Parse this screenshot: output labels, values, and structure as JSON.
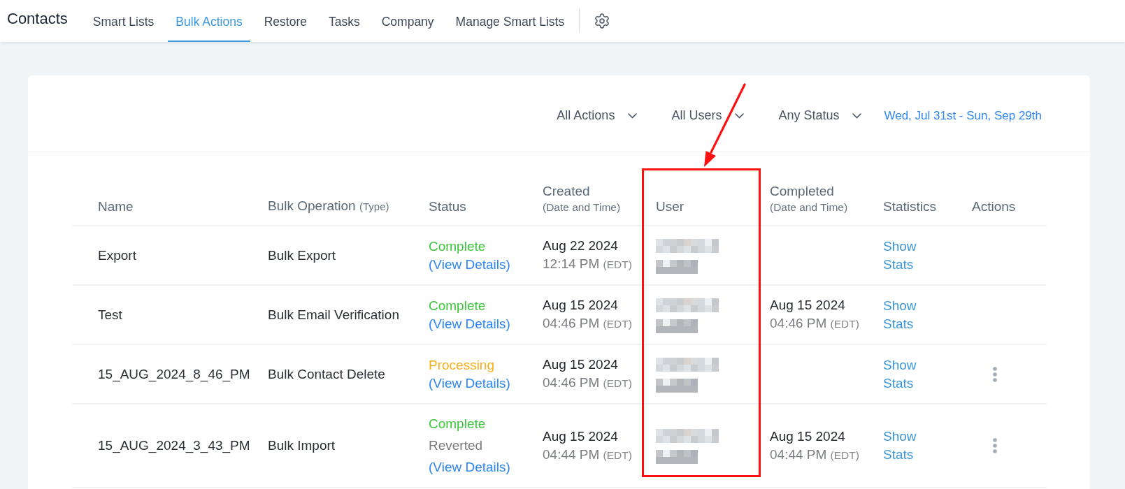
{
  "top_bar": {
    "title": "Contacts",
    "tabs": [
      {
        "label": "Smart Lists",
        "selected": false
      },
      {
        "label": "Bulk Actions",
        "selected": true
      },
      {
        "label": "Restore",
        "selected": false
      },
      {
        "label": "Tasks",
        "selected": false
      },
      {
        "label": "Company",
        "selected": false
      },
      {
        "label": "Manage Smart Lists",
        "selected": false
      }
    ]
  },
  "filters": [
    {
      "label": "All Actions"
    },
    {
      "label": "All Users"
    },
    {
      "label": "Any Status"
    }
  ],
  "date_range": "Wed, Jul 31st - Sun, Sep 29th",
  "table": {
    "columns": [
      {
        "label": "Name",
        "kind": "plain"
      },
      {
        "label": "Bulk Operation",
        "note": "(Type)",
        "kind": "inline"
      },
      {
        "label": "Status",
        "kind": "plain"
      },
      {
        "label": "Created",
        "note": "(Date and Time)",
        "kind": "stacked"
      },
      {
        "label": "User",
        "kind": "plain"
      },
      {
        "label": "Completed",
        "note": "(Date and Time)",
        "kind": "stacked"
      },
      {
        "label": "Statistics",
        "kind": "plain"
      },
      {
        "label": "Actions",
        "kind": "plain"
      }
    ],
    "rows": [
      {
        "name": "Export",
        "operation": "Bulk Export",
        "status": [
          {
            "label": "Complete",
            "kind": "complete"
          }
        ],
        "details_link": "(View Details)",
        "created": {
          "date": "Aug 22 2024",
          "time": "12:14 PM",
          "zone": "(EDT)"
        },
        "stats_link": "Show Stats",
        "menu": false
      },
      {
        "name": "Test",
        "operation": "Bulk Email Verification",
        "status": [
          {
            "label": "Complete",
            "kind": "complete"
          }
        ],
        "details_link": "(View Details)",
        "created": {
          "date": "Aug 15 2024",
          "time": "04:46 PM",
          "zone": "(EDT)"
        },
        "completed": {
          "date": "Aug 15 2024",
          "time": "04:46 PM",
          "zone": "(EDT)"
        },
        "stats_link": "Show Stats",
        "menu": false
      },
      {
        "name": "15_AUG_2024_8_46_PM",
        "operation": "Bulk Contact Delete",
        "status": [
          {
            "label": "Processing",
            "kind": "processing"
          }
        ],
        "details_link": "(View Details)",
        "created": {
          "date": "Aug 15 2024",
          "time": "04:46 PM",
          "zone": "(EDT)"
        },
        "stats_link": "Show Stats",
        "menu": true
      },
      {
        "name": "15_AUG_2024_3_43_PM",
        "operation": "Bulk Import",
        "status": [
          {
            "label": "Complete",
            "kind": "complete"
          },
          {
            "label": "Reverted",
            "kind": "reverted"
          }
        ],
        "details_link": "(View Details)",
        "created": {
          "date": "Aug 15 2024",
          "time": "04:44 PM",
          "zone": "(EDT)"
        },
        "completed": {
          "date": "Aug 15 2024",
          "time": "04:44 PM",
          "zone": "(EDT)"
        },
        "stats_link": "Show Stats",
        "menu": true
      }
    ]
  }
}
